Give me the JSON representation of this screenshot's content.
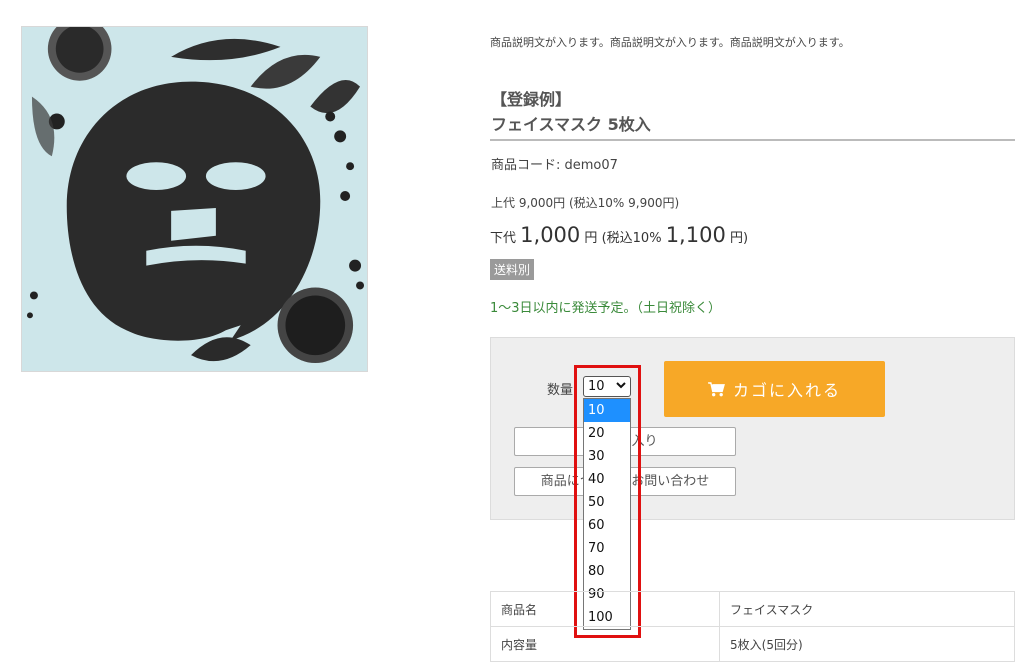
{
  "product": {
    "description": "商品説明文が入ります。商品説明文が入ります。商品説明文が入ります。",
    "label_example": "【登録例】",
    "title": "フェイスマスク 5枚入",
    "code_label": "商品コード: demo07",
    "retail_price_text": "上代 9,000円 (税込10% 9,900円)",
    "wholesale": {
      "label": "下代",
      "price": "1,000",
      "yen": "円",
      "tax_prefix": "(税込10%",
      "tax_price": "1,100",
      "tax_suffix": "円)"
    },
    "shipping_badge": "送料別",
    "shipping_note": "1〜3日以内に発送予定。（土日祝除く）"
  },
  "cart": {
    "quantity_label": "数量:",
    "selected_quantity": "10",
    "add_to_cart_label": "カゴに入れる",
    "favorite_label": "お気に入り",
    "inquiry_label": "商品についてのお問い合わせ"
  },
  "quantity_options": [
    "10",
    "20",
    "30",
    "40",
    "50",
    "60",
    "70",
    "80",
    "90",
    "100"
  ],
  "specs": [
    {
      "key": "商品名",
      "value": "フェイスマスク"
    },
    {
      "key": "内容量",
      "value": "5枚入(5回分)"
    }
  ],
  "colors": {
    "cart_button": "#f7a827",
    "dropdown_selected": "#1e90ff",
    "highlight": "#e01010",
    "shipping_note": "#3a8a3a"
  },
  "icons": {
    "cart": "cart-icon",
    "chevron": "chevron-down-icon"
  }
}
